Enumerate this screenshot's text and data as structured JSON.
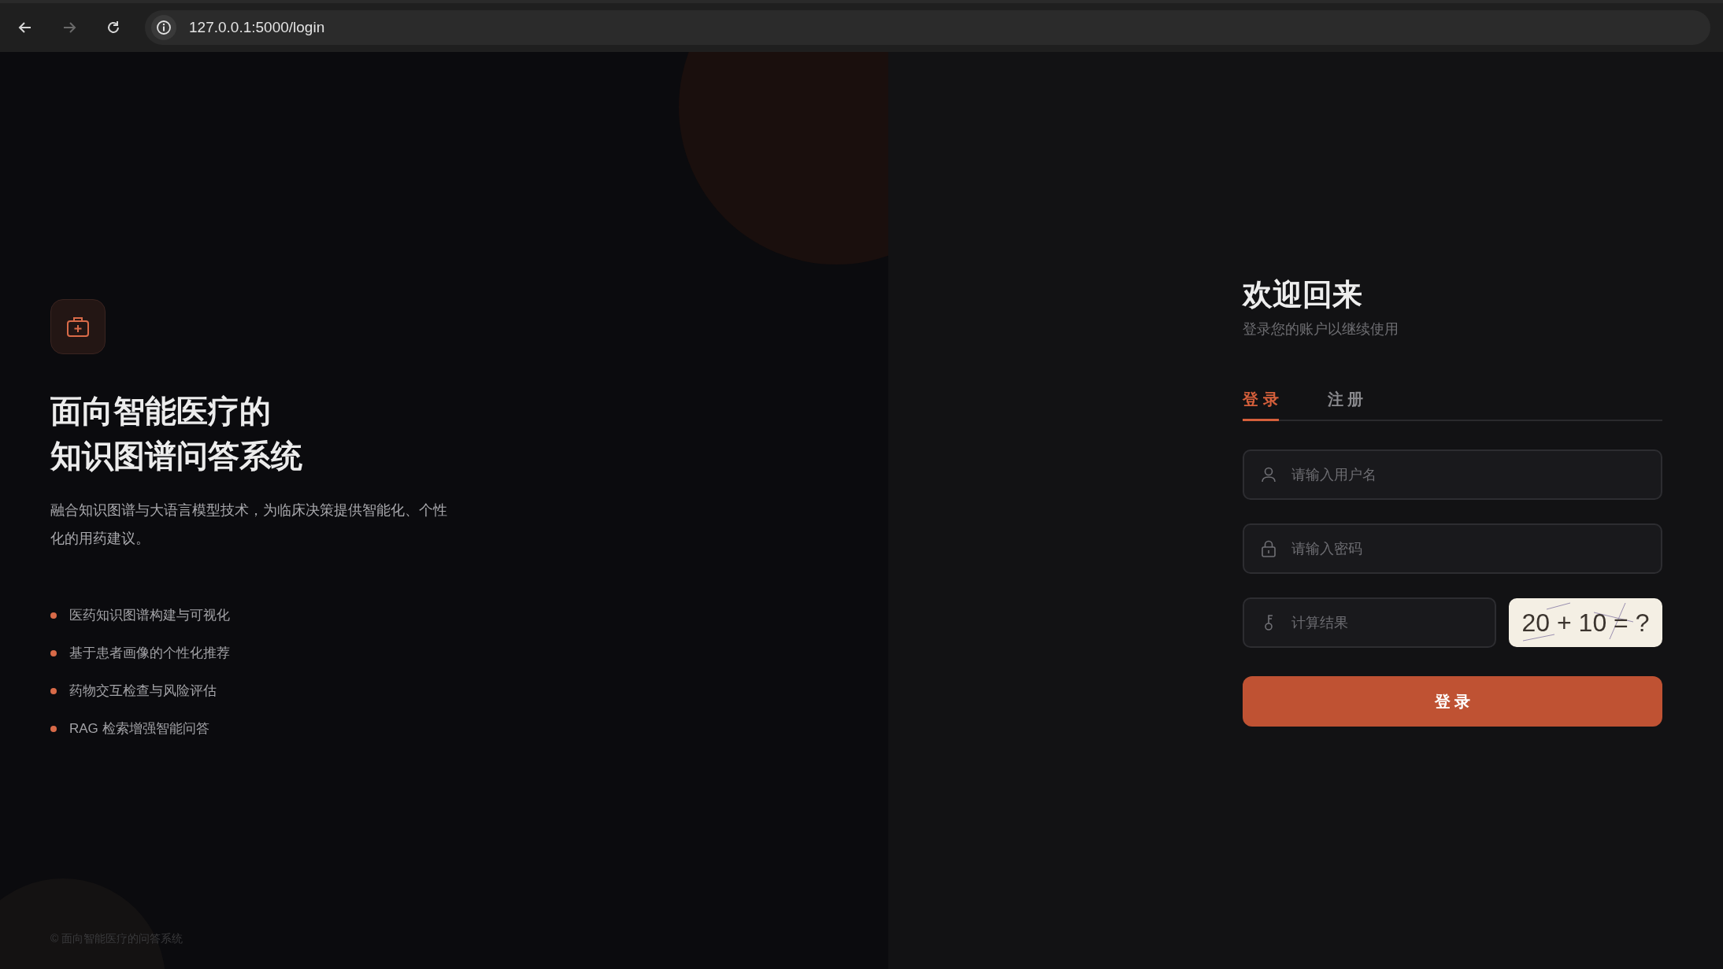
{
  "browser": {
    "url": "127.0.0.1:5000/login",
    "back_disabled": false,
    "forward_disabled": true
  },
  "intro": {
    "title_lines": [
      "面向智能医疗的",
      "知识图谱问答系统"
    ],
    "description": "融合知识图谱与大语言模型技术，为临床决策提供智能化、个性化的用药建议。",
    "features": [
      "医药知识图谱构建与可视化",
      "基于患者画像的个性化推荐",
      "药物交互检查与风险评估",
      "RAG 检索增强智能问答"
    ],
    "footer": "© 面向智能医疗的问答系统"
  },
  "form": {
    "title": "欢迎回来",
    "subtitle": "登录您的账户以继续使用",
    "tabs": [
      {
        "label": "登 录",
        "selected": true
      },
      {
        "label": "注 册",
        "selected": false
      }
    ],
    "fields": [
      {
        "kind": "user",
        "placeholder": "请输入用户名"
      },
      {
        "kind": "lock",
        "placeholder": "请输入密码"
      },
      {
        "kind": "key",
        "placeholder": "计算结果"
      }
    ],
    "captcha": "20 + 10 = ?",
    "submit": "登 录"
  }
}
